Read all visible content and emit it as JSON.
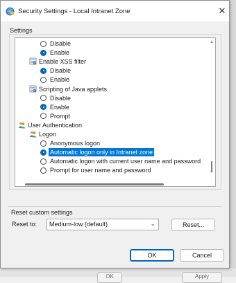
{
  "dialog": {
    "title": "Security Settings - Local Intranet Zone",
    "title_icon": "shield-globe-icon",
    "close_glyph": "✕"
  },
  "settings_group": {
    "label": "Settings",
    "tree": [
      {
        "kind": "radio",
        "label": "Disable",
        "checked": false
      },
      {
        "kind": "radio",
        "label": "Enable",
        "checked": true
      },
      {
        "kind": "setting",
        "label": "Enable XSS filter",
        "icon": "settings-page-icon"
      },
      {
        "kind": "radio",
        "label": "Disable",
        "checked": true
      },
      {
        "kind": "radio",
        "label": "Enable",
        "checked": false
      },
      {
        "kind": "setting",
        "label": "Scripting of Java applets",
        "icon": "settings-page-icon"
      },
      {
        "kind": "radio",
        "label": "Disable",
        "checked": false
      },
      {
        "kind": "radio",
        "label": "Enable",
        "checked": true
      },
      {
        "kind": "radio",
        "label": "Prompt",
        "checked": false
      },
      {
        "kind": "category",
        "label": "User Authentication",
        "icon": "users-icon"
      },
      {
        "kind": "setting",
        "label": "Logon",
        "icon": "users-icon"
      },
      {
        "kind": "radio",
        "label": "Anonymous logon",
        "checked": false
      },
      {
        "kind": "radio",
        "label": "Automatic logon only in Intranet zone",
        "checked": true,
        "selected": true
      },
      {
        "kind": "radio",
        "label": "Automatic logon with current user name and password",
        "checked": false
      },
      {
        "kind": "radio",
        "label": "Prompt for user name and password",
        "checked": false
      }
    ]
  },
  "reset": {
    "group_label": "Reset custom settings",
    "reset_to_label": "Reset to:",
    "selected_option": "Medium-low (default)",
    "reset_button": "Reset..."
  },
  "footer": {
    "ok_label": "OK",
    "cancel_label": "Cancel"
  },
  "background": {
    "ok_label": "OK",
    "apply_label": "Apply"
  },
  "colors": {
    "accent": "#0067c0",
    "selection": "#0078d4"
  }
}
